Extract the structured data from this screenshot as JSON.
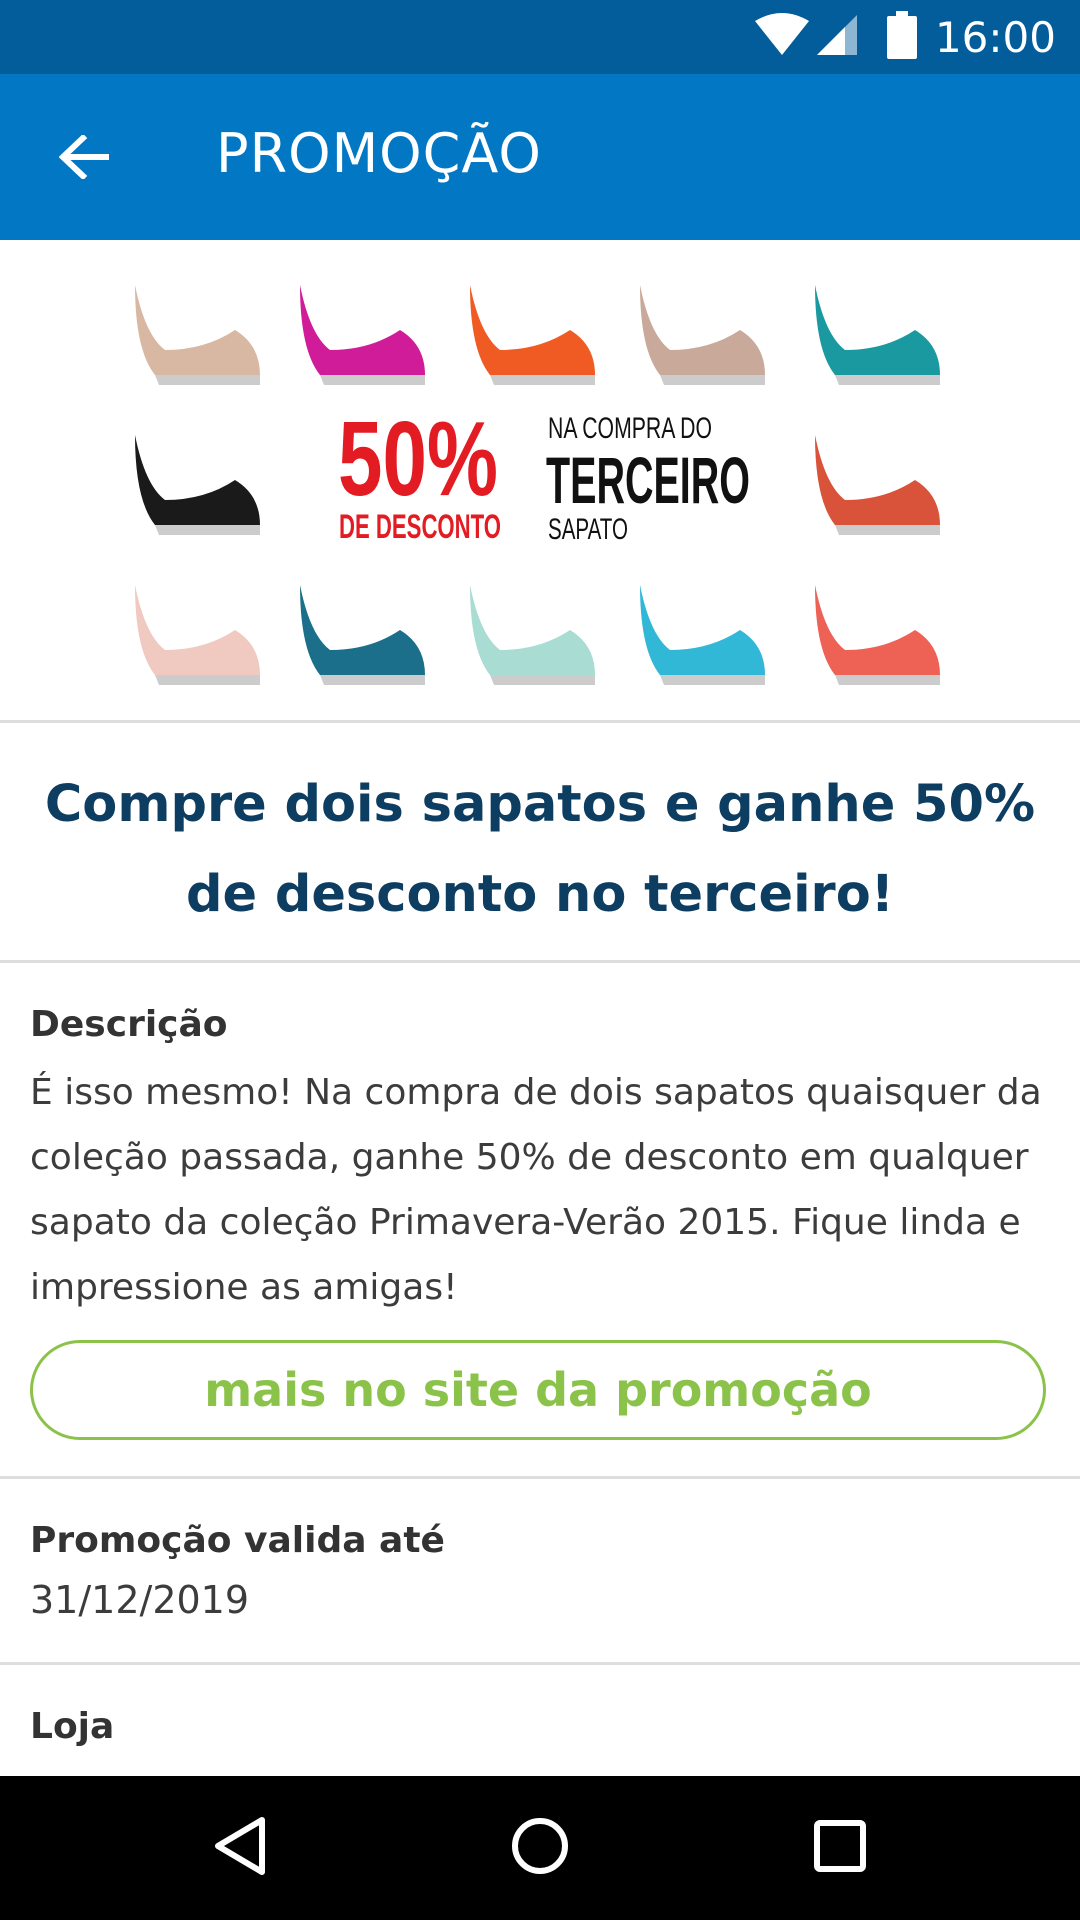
{
  "status_bar": {
    "time": "16:00"
  },
  "app_bar": {
    "title": "PROMOÇÃO"
  },
  "banner": {
    "discount": "50%",
    "discount_label": "DE DESCONTO",
    "line1": "NA COMPRA DO",
    "line2": "TERCEIRO",
    "line3": "SAPATO",
    "shoe_colors": [
      "#d9b8a3",
      "#d11c9a",
      "#f05a23",
      "#c9a99a",
      "#1a9aa0",
      "#1a1a1a",
      "#d9523a",
      "#f0c9c0",
      "#1b6f8a",
      "#a9dcd2",
      "#30b8d6",
      "#ee6155"
    ]
  },
  "headline": "Compre dois sapatos e ganhe 50% de desconto no terceiro!",
  "description": {
    "label": "Descrição",
    "text": "É isso mesmo! Na compra de dois sapatos quaisquer da coleção passada, ganhe 50% de desconto em qualquer sapato da coleção Primavera-Verão 2015. Fique linda e impressione as amigas!"
  },
  "promo_link": {
    "label": "mais no site da promoção"
  },
  "validity": {
    "label": "Promoção valida até",
    "date": "31/12/2019"
  },
  "store": {
    "label": "Loja"
  },
  "colors": {
    "status_bar": "#035d9b",
    "app_bar": "#0277c4",
    "headline": "#0d3d60",
    "accent_green": "#8bc34a"
  }
}
